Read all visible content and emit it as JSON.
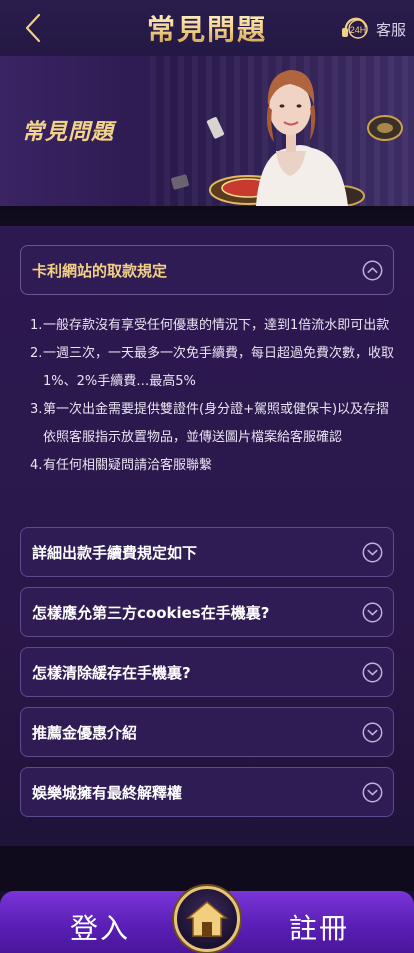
{
  "header": {
    "title": "常見問題",
    "service_label": "客服",
    "service_badge": "24H"
  },
  "banner": {
    "title": "常見問題"
  },
  "faq": {
    "items": [
      {
        "label": "卡利網站的取款規定",
        "expanded": true
      },
      {
        "label": "詳細出款手續費規定如下",
        "expanded": false
      },
      {
        "label": "怎樣應允第三方cookies在手機裏?",
        "expanded": false
      },
      {
        "label": "怎樣清除緩存在手機裏?",
        "expanded": false
      },
      {
        "label": "推薦金優惠介紹",
        "expanded": false
      },
      {
        "label": "娛樂城擁有最終解釋權",
        "expanded": false
      }
    ],
    "answer": [
      {
        "num": "1.",
        "text": "一般存款沒有享受任何優惠的情況下，達到1倍流水即可出款"
      },
      {
        "num": "2.",
        "text": "一週三次，一天最多一次免手續費，每日超過免費次數，收取1%、2%手續費…最高5%"
      },
      {
        "num": "3.",
        "text": "第一次出金需要提供雙證件(身分證+駕照或健保卡)以及存摺依照客服指示放置物品，並傳送圖片檔案給客服確認"
      },
      {
        "num": "4.",
        "text": "有任何相關疑問請洽客服聯繫"
      }
    ]
  },
  "bottom": {
    "login_label": "登入",
    "register_label": "註冊"
  },
  "colors": {
    "gold": "#f1cf86",
    "purple_bar": "#6a2ccb",
    "panel": "#2f1c55"
  }
}
